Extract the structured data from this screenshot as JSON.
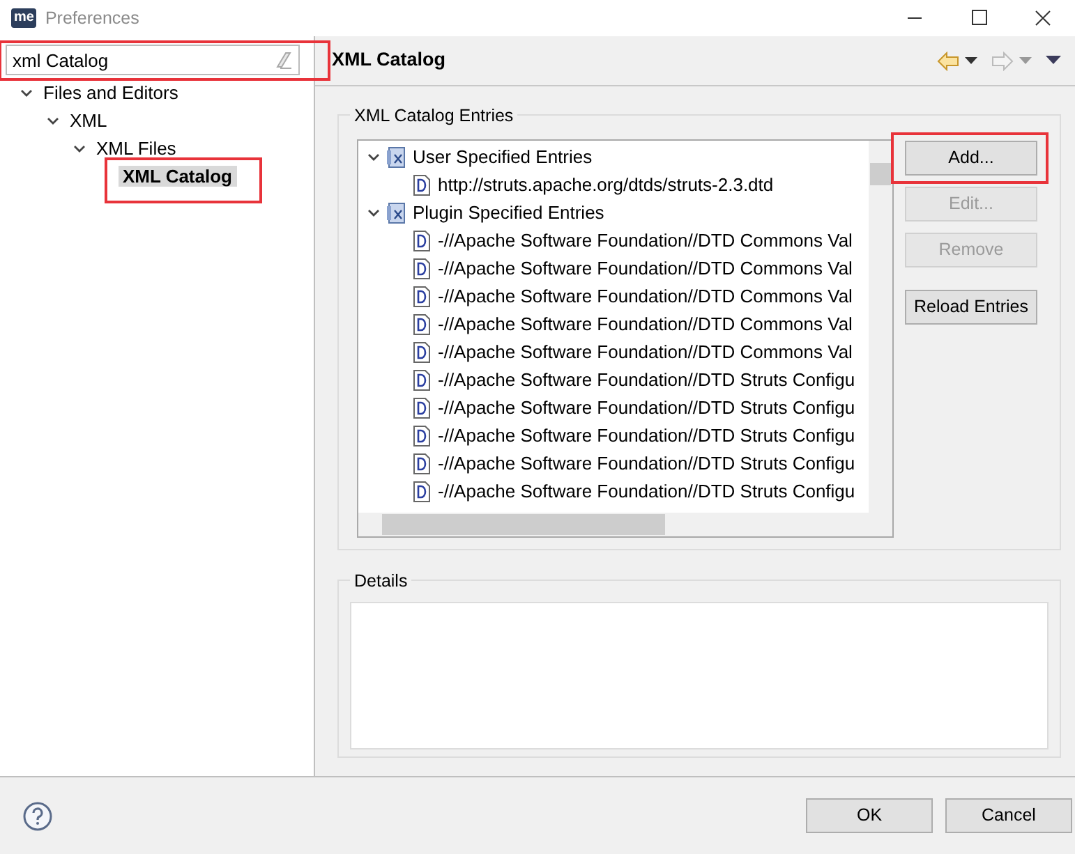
{
  "window": {
    "title": "Preferences",
    "app_badge": "me"
  },
  "filter": {
    "value": "xml Catalog",
    "highlighted": true
  },
  "nav_tree": [
    {
      "label": "Files and Editors",
      "expanded": true,
      "selected": false,
      "highlighted": false,
      "children": [
        {
          "label": "XML",
          "expanded": true,
          "selected": false,
          "highlighted": false,
          "children": [
            {
              "label": "XML Files",
              "expanded": true,
              "selected": false,
              "highlighted": false,
              "children": [
                {
                  "label": "XML Catalog",
                  "selected": true,
                  "highlighted": true
                }
              ]
            }
          ]
        }
      ]
    }
  ],
  "page": {
    "title": "XML Catalog"
  },
  "entries_group": {
    "title": "XML Catalog Entries",
    "tree": [
      {
        "label": "User Specified Entries",
        "kind": "catalog",
        "expanded": true,
        "children": [
          {
            "label": "http://struts.apache.org/dtds/struts-2.3.dtd",
            "kind": "dtd"
          }
        ]
      },
      {
        "label": "Plugin Specified Entries",
        "kind": "catalog",
        "expanded": true,
        "children": [
          {
            "label": "-//Apache Software Foundation//DTD Commons Val",
            "kind": "dtd"
          },
          {
            "label": "-//Apache Software Foundation//DTD Commons Val",
            "kind": "dtd"
          },
          {
            "label": "-//Apache Software Foundation//DTD Commons Val",
            "kind": "dtd"
          },
          {
            "label": "-//Apache Software Foundation//DTD Commons Val",
            "kind": "dtd"
          },
          {
            "label": "-//Apache Software Foundation//DTD Commons Val",
            "kind": "dtd"
          },
          {
            "label": "-//Apache Software Foundation//DTD Struts Configu",
            "kind": "dtd"
          },
          {
            "label": "-//Apache Software Foundation//DTD Struts Configu",
            "kind": "dtd"
          },
          {
            "label": "-//Apache Software Foundation//DTD Struts Configu",
            "kind": "dtd"
          },
          {
            "label": "-//Apache Software Foundation//DTD Struts Configu",
            "kind": "dtd"
          },
          {
            "label": "-//Apache Software Foundation//DTD Struts Configu",
            "kind": "dtd"
          }
        ]
      }
    ],
    "buttons": [
      {
        "label": "Add...",
        "disabled": false,
        "highlighted": true
      },
      {
        "label": "Edit...",
        "disabled": true,
        "highlighted": false
      },
      {
        "label": "Remove",
        "disabled": true,
        "highlighted": false
      },
      {
        "label": "Reload Entries",
        "disabled": false,
        "highlighted": false
      }
    ]
  },
  "details_group": {
    "title": "Details"
  },
  "footer_buttons": [
    {
      "label": "OK"
    },
    {
      "label": "Cancel"
    }
  ]
}
